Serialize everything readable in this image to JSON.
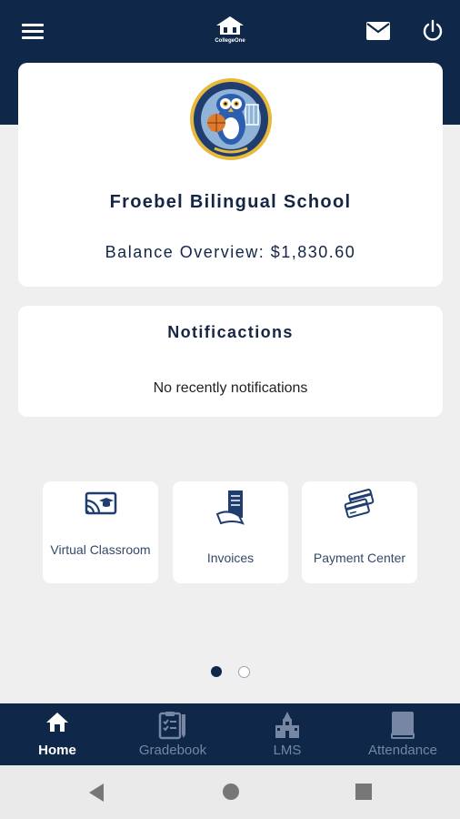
{
  "header": {
    "logo_text": "CollegeOne",
    "icons": {
      "menu": "hamburger-menu-icon",
      "mail": "mail-icon",
      "logout": "power-icon"
    }
  },
  "school": {
    "name": "Froebel Bilingual School",
    "balance_label": "Balance Overview: $1,830.60",
    "crest_icon": "owl-crest-icon"
  },
  "notifications": {
    "title": "Notificactions",
    "empty_text": "No recently notifications"
  },
  "tiles": [
    {
      "label": "Virtual Classroom",
      "icon": "virtual-classroom-icon"
    },
    {
      "label": "Invoices",
      "icon": "invoice-icon"
    },
    {
      "label": "Payment Center",
      "icon": "credit-card-icon"
    }
  ],
  "pager": {
    "active_index": 0,
    "count": 2
  },
  "bottom_nav": [
    {
      "label": "Home",
      "icon": "home-icon",
      "active": true
    },
    {
      "label": "Gradebook",
      "icon": "gradebook-icon",
      "active": false
    },
    {
      "label": "LMS",
      "icon": "lms-building-icon",
      "active": false
    },
    {
      "label": "Attendance",
      "icon": "attendance-book-icon",
      "active": false
    }
  ],
  "colors": {
    "primary": "#0f2748",
    "background": "#efefef",
    "card": "#ffffff",
    "nav_inactive": "#7686a3"
  }
}
